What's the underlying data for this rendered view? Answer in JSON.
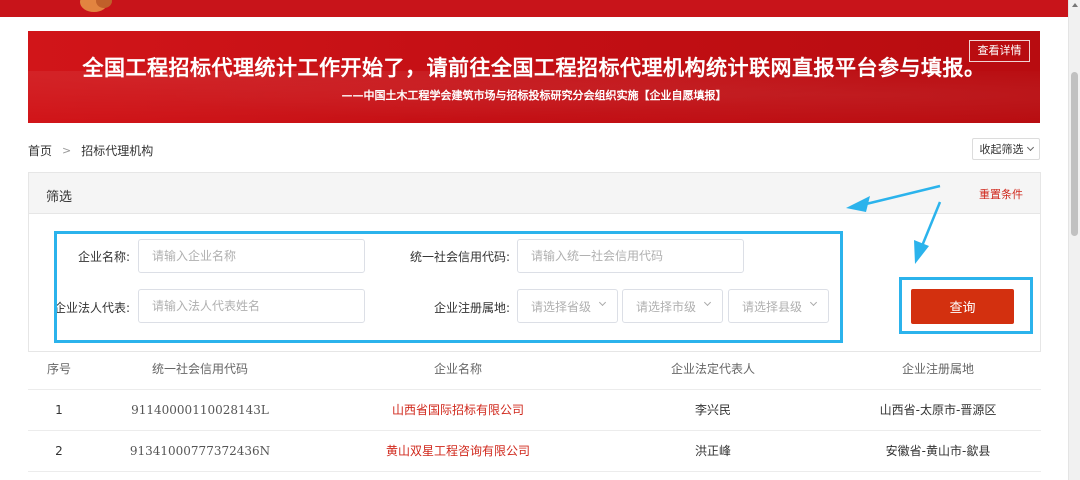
{
  "banner": {
    "headline": "全国工程招标代理统计工作开始了，请前往全国工程招标代理机构统计联网直报平台参与填报。",
    "subline": "——中国土木工程学会建筑市场与招标投标研究分会组织实施【企业自愿填报】",
    "detail_button": "查看详情"
  },
  "breadcrumb": {
    "home": "首页",
    "current": "招标代理机构"
  },
  "collapse_button": "收起筛选",
  "filter": {
    "title": "筛选",
    "reset": "重置条件",
    "company_name_label": "企业名称:",
    "company_name_placeholder": "请输入企业名称",
    "credit_code_label": "统一社会信用代码:",
    "credit_code_placeholder": "请输入统一社会信用代码",
    "legal_rep_label": "企业法人代表:",
    "legal_rep_placeholder": "请输入法人代表姓名",
    "location_label": "企业注册属地:",
    "province_placeholder": "请选择省级",
    "city_placeholder": "请选择市级",
    "county_placeholder": "请选择县级",
    "query_button": "查询"
  },
  "table": {
    "headers": [
      "序号",
      "统一社会信用代码",
      "企业名称",
      "企业法定代表人",
      "企业注册属地"
    ],
    "rows": [
      [
        "1",
        "91140000110028143L",
        "山西省国际招标有限公司",
        "李兴民",
        "山西省-太原市-晋源区"
      ],
      [
        "2",
        "91341000777372436N",
        "黄山双星工程咨询有限公司",
        "洪正峰",
        "安徽省-黄山市-歙县"
      ]
    ]
  },
  "colors": {
    "banner_red": "#c8141a",
    "accent_red": "#d3300f",
    "highlight_blue": "#2bb3ec"
  }
}
